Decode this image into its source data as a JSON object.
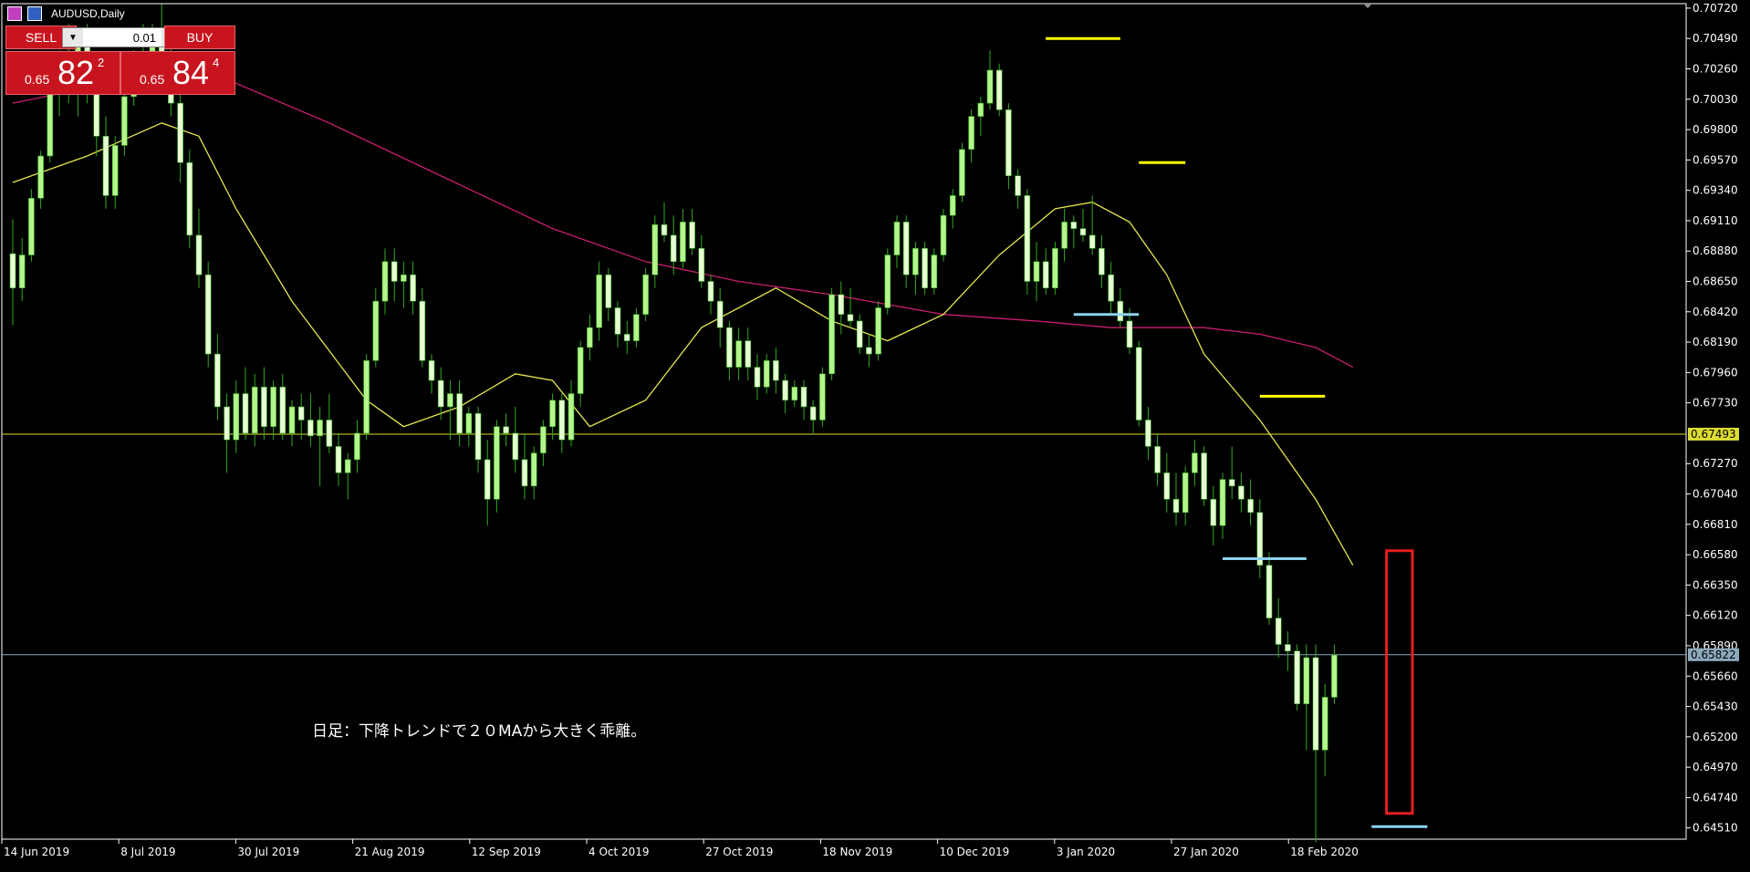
{
  "window": {
    "title": "AUDUSD,Daily"
  },
  "trade_panel": {
    "sell_label": "SELL",
    "buy_label": "BUY",
    "lot_value": "0.01",
    "sell_price": {
      "prefix": "0.65",
      "big": "82",
      "sup": "2"
    },
    "buy_price": {
      "prefix": "0.65",
      "big": "84",
      "sup": "4"
    }
  },
  "annotation": "日足：下降トレンドで２０MAから大きく乖離。",
  "colors": {
    "background": "#000000",
    "candle_bull": "#b4f58c",
    "candle_bear": "#e6ffd2",
    "wick": "#32aa1e",
    "ma20": "#e6e650",
    "ma_long": "#c81e6e",
    "hline_yellow": "#dcdc32",
    "hline_price": "#8caabe",
    "marker_yellow": "#ffff00",
    "marker_blue": "#8cd2f0",
    "highlight_box": "#e61e1e",
    "axis_text": "#ffffff"
  },
  "chart_data": {
    "type": "candlestick",
    "symbol": "AUDUSD",
    "timeframe": "Daily",
    "y_ticks": [
      "0.70720",
      "0.70490",
      "0.70260",
      "0.70030",
      "0.69800",
      "0.69570",
      "0.69340",
      "0.69110",
      "0.68880",
      "0.68650",
      "0.68420",
      "0.68190",
      "0.67960",
      "0.67730",
      "0.67270",
      "0.67040",
      "0.66810",
      "0.66580",
      "0.66350",
      "0.66120",
      "0.65890",
      "0.65660",
      "0.65430",
      "0.65200",
      "0.64970",
      "0.64740",
      "0.64510"
    ],
    "ylim": [
      0.64425,
      0.70754
    ],
    "x_ticks": [
      "14 Jun 2019",
      "8 Jul 2019",
      "30 Jul 2019",
      "21 Aug 2019",
      "12 Sep 2019",
      "4 Oct 2019",
      "27 Oct 2019",
      "18 Nov 2019",
      "10 Dec 2019",
      "3 Jan 2020",
      "27 Jan 2020",
      "18 Feb 2020"
    ],
    "horizontal_lines": [
      {
        "price": 0.67493,
        "label": "0.67493",
        "color": "yellow"
      },
      {
        "price": 0.65822,
        "label": "0.65822",
        "color": "grey-blue"
      }
    ],
    "candles": [
      [
        0.6886,
        0.6912,
        0.6832,
        0.686
      ],
      [
        0.686,
        0.6898,
        0.685,
        0.6885
      ],
      [
        0.6885,
        0.6935,
        0.688,
        0.6928
      ],
      [
        0.6928,
        0.6964,
        0.692,
        0.696
      ],
      [
        0.696,
        0.7015,
        0.6955,
        0.7008
      ],
      [
        0.7008,
        0.704,
        0.699,
        0.703
      ],
      [
        0.703,
        0.706,
        0.7,
        0.701
      ],
      [
        0.701,
        0.7055,
        0.699,
        0.7045
      ],
      [
        0.7045,
        0.706,
        0.7,
        0.7015
      ],
      [
        0.7015,
        0.703,
        0.696,
        0.6975
      ],
      [
        0.6975,
        0.699,
        0.692,
        0.693
      ],
      [
        0.693,
        0.6975,
        0.692,
        0.6968
      ],
      [
        0.6968,
        0.701,
        0.696,
        0.7005
      ],
      [
        0.7005,
        0.704,
        0.6998,
        0.703
      ],
      [
        0.703,
        0.706,
        0.7015,
        0.702
      ],
      [
        0.702,
        0.706,
        0.701,
        0.705
      ],
      [
        0.705,
        0.7075,
        0.702,
        0.703
      ],
      [
        0.703,
        0.7045,
        0.699,
        0.7
      ],
      [
        0.7,
        0.701,
        0.694,
        0.6955
      ],
      [
        0.6955,
        0.6965,
        0.689,
        0.69
      ],
      [
        0.69,
        0.692,
        0.686,
        0.687
      ],
      [
        0.687,
        0.688,
        0.68,
        0.681
      ],
      [
        0.681,
        0.6825,
        0.676,
        0.677
      ],
      [
        0.677,
        0.678,
        0.672,
        0.6745
      ],
      [
        0.6745,
        0.679,
        0.6735,
        0.678
      ],
      [
        0.678,
        0.68,
        0.6745,
        0.675
      ],
      [
        0.675,
        0.6795,
        0.674,
        0.6785
      ],
      [
        0.6785,
        0.68,
        0.6745,
        0.6755
      ],
      [
        0.6755,
        0.679,
        0.6745,
        0.6785
      ],
      [
        0.6785,
        0.6795,
        0.6745,
        0.675
      ],
      [
        0.675,
        0.6775,
        0.674,
        0.677
      ],
      [
        0.677,
        0.678,
        0.6745,
        0.676
      ],
      [
        0.676,
        0.678,
        0.674,
        0.6748
      ],
      [
        0.6748,
        0.677,
        0.671,
        0.676
      ],
      [
        0.676,
        0.678,
        0.6735,
        0.674
      ],
      [
        0.674,
        0.675,
        0.671,
        0.672
      ],
      [
        0.672,
        0.6735,
        0.67,
        0.673
      ],
      [
        0.673,
        0.676,
        0.672,
        0.675
      ],
      [
        0.675,
        0.681,
        0.6745,
        0.6805
      ],
      [
        0.6805,
        0.686,
        0.68,
        0.685
      ],
      [
        0.685,
        0.689,
        0.684,
        0.688
      ],
      [
        0.688,
        0.689,
        0.685,
        0.6865
      ],
      [
        0.6865,
        0.688,
        0.6845,
        0.687
      ],
      [
        0.687,
        0.688,
        0.684,
        0.685
      ],
      [
        0.685,
        0.686,
        0.68,
        0.6805
      ],
      [
        0.6805,
        0.681,
        0.678,
        0.679
      ],
      [
        0.679,
        0.68,
        0.676,
        0.677
      ],
      [
        0.677,
        0.679,
        0.6745,
        0.678
      ],
      [
        0.678,
        0.679,
        0.674,
        0.675
      ],
      [
        0.675,
        0.677,
        0.674,
        0.6765
      ],
      [
        0.6765,
        0.677,
        0.672,
        0.673
      ],
      [
        0.673,
        0.6745,
        0.668,
        0.67
      ],
      [
        0.67,
        0.676,
        0.669,
        0.6755
      ],
      [
        0.6755,
        0.6765,
        0.674,
        0.675
      ],
      [
        0.675,
        0.677,
        0.672,
        0.673
      ],
      [
        0.673,
        0.675,
        0.67,
        0.671
      ],
      [
        0.671,
        0.674,
        0.67,
        0.6735
      ],
      [
        0.6735,
        0.676,
        0.6725,
        0.6755
      ],
      [
        0.6755,
        0.678,
        0.6745,
        0.6775
      ],
      [
        0.6775,
        0.678,
        0.6735,
        0.6745
      ],
      [
        0.6745,
        0.679,
        0.674,
        0.678
      ],
      [
        0.678,
        0.682,
        0.677,
        0.6815
      ],
      [
        0.6815,
        0.684,
        0.6805,
        0.683
      ],
      [
        0.683,
        0.688,
        0.682,
        0.687
      ],
      [
        0.687,
        0.6875,
        0.6835,
        0.6845
      ],
      [
        0.6845,
        0.685,
        0.6815,
        0.6825
      ],
      [
        0.6825,
        0.6835,
        0.681,
        0.682
      ],
      [
        0.682,
        0.6845,
        0.6815,
        0.684
      ],
      [
        0.684,
        0.6875,
        0.6835,
        0.687
      ],
      [
        0.687,
        0.6915,
        0.686,
        0.6908
      ],
      [
        0.6908,
        0.6925,
        0.6895,
        0.69
      ],
      [
        0.69,
        0.6915,
        0.687,
        0.688
      ],
      [
        0.688,
        0.692,
        0.6875,
        0.691
      ],
      [
        0.691,
        0.692,
        0.6885,
        0.689
      ],
      [
        0.689,
        0.69,
        0.686,
        0.6865
      ],
      [
        0.6865,
        0.687,
        0.684,
        0.685
      ],
      [
        0.685,
        0.686,
        0.6815,
        0.683
      ],
      [
        0.683,
        0.6835,
        0.679,
        0.68
      ],
      [
        0.68,
        0.683,
        0.679,
        0.682
      ],
      [
        0.682,
        0.683,
        0.679,
        0.68
      ],
      [
        0.68,
        0.681,
        0.6775,
        0.6785
      ],
      [
        0.6785,
        0.681,
        0.678,
        0.6805
      ],
      [
        0.6805,
        0.6815,
        0.678,
        0.679
      ],
      [
        0.679,
        0.6795,
        0.6765,
        0.6775
      ],
      [
        0.6775,
        0.679,
        0.677,
        0.6785
      ],
      [
        0.6785,
        0.679,
        0.676,
        0.677
      ],
      [
        0.677,
        0.6775,
        0.675,
        0.676
      ],
      [
        0.676,
        0.68,
        0.6755,
        0.6795
      ],
      [
        0.6795,
        0.686,
        0.679,
        0.6855
      ],
      [
        0.6855,
        0.6865,
        0.6825,
        0.684
      ],
      [
        0.684,
        0.686,
        0.683,
        0.6835
      ],
      [
        0.6835,
        0.684,
        0.681,
        0.6815
      ],
      [
        0.6815,
        0.6825,
        0.68,
        0.681
      ],
      [
        0.681,
        0.685,
        0.6805,
        0.6845
      ],
      [
        0.6845,
        0.689,
        0.684,
        0.6885
      ],
      [
        0.6885,
        0.6915,
        0.6875,
        0.691
      ],
      [
        0.691,
        0.6915,
        0.686,
        0.687
      ],
      [
        0.687,
        0.6895,
        0.6855,
        0.689
      ],
      [
        0.689,
        0.6895,
        0.6855,
        0.686
      ],
      [
        0.686,
        0.689,
        0.6855,
        0.6885
      ],
      [
        0.6885,
        0.692,
        0.688,
        0.6915
      ],
      [
        0.6915,
        0.6935,
        0.6905,
        0.693
      ],
      [
        0.693,
        0.697,
        0.6925,
        0.6965
      ],
      [
        0.6965,
        0.6995,
        0.6955,
        0.699
      ],
      [
        0.699,
        0.7005,
        0.6975,
        0.7
      ],
      [
        0.7,
        0.704,
        0.6995,
        0.7025
      ],
      [
        0.7025,
        0.703,
        0.699,
        0.6995
      ],
      [
        0.6995,
        0.7,
        0.6935,
        0.6945
      ],
      [
        0.6945,
        0.695,
        0.692,
        0.693
      ],
      [
        0.693,
        0.6935,
        0.6855,
        0.6865
      ],
      [
        0.6865,
        0.6895,
        0.685,
        0.688
      ],
      [
        0.688,
        0.689,
        0.6855,
        0.686
      ],
      [
        0.686,
        0.6895,
        0.6855,
        0.689
      ],
      [
        0.689,
        0.692,
        0.688,
        0.691
      ],
      [
        0.691,
        0.6915,
        0.689,
        0.6905
      ],
      [
        0.6905,
        0.692,
        0.6895,
        0.69
      ],
      [
        0.69,
        0.693,
        0.6885,
        0.689
      ],
      [
        0.689,
        0.69,
        0.686,
        0.687
      ],
      [
        0.687,
        0.688,
        0.684,
        0.685
      ],
      [
        0.685,
        0.686,
        0.683,
        0.6835
      ],
      [
        0.6835,
        0.6845,
        0.681,
        0.6815
      ],
      [
        0.6815,
        0.682,
        0.6755,
        0.676
      ],
      [
        0.676,
        0.677,
        0.673,
        0.674
      ],
      [
        0.674,
        0.675,
        0.671,
        0.672
      ],
      [
        0.672,
        0.6735,
        0.669,
        0.67
      ],
      [
        0.67,
        0.672,
        0.668,
        0.669
      ],
      [
        0.669,
        0.6725,
        0.668,
        0.672
      ],
      [
        0.672,
        0.6745,
        0.671,
        0.6735
      ],
      [
        0.6735,
        0.674,
        0.6695,
        0.67
      ],
      [
        0.67,
        0.671,
        0.6665,
        0.668
      ],
      [
        0.668,
        0.672,
        0.667,
        0.6715
      ],
      [
        0.6715,
        0.674,
        0.67,
        0.671
      ],
      [
        0.671,
        0.672,
        0.669,
        0.67
      ],
      [
        0.67,
        0.6715,
        0.668,
        0.669
      ],
      [
        0.669,
        0.67,
        0.664,
        0.665
      ],
      [
        0.665,
        0.666,
        0.6605,
        0.661
      ],
      [
        0.661,
        0.6625,
        0.658,
        0.659
      ],
      [
        0.659,
        0.66,
        0.657,
        0.6585
      ],
      [
        0.6585,
        0.659,
        0.654,
        0.6545
      ],
      [
        0.6545,
        0.659,
        0.651,
        0.658
      ],
      [
        0.658,
        0.659,
        0.644,
        0.651
      ],
      [
        0.651,
        0.656,
        0.649,
        0.655
      ],
      [
        0.655,
        0.659,
        0.6545,
        0.6582
      ]
    ],
    "ma20": [
      [
        0,
        0.694
      ],
      [
        8,
        0.696
      ],
      [
        16,
        0.6985
      ],
      [
        20,
        0.6975
      ],
      [
        24,
        0.692
      ],
      [
        30,
        0.685
      ],
      [
        38,
        0.6775
      ],
      [
        42,
        0.6755
      ],
      [
        48,
        0.677
      ],
      [
        54,
        0.6795
      ],
      [
        58,
        0.679
      ],
      [
        62,
        0.6755
      ],
      [
        68,
        0.6775
      ],
      [
        74,
        0.683
      ],
      [
        82,
        0.686
      ],
      [
        88,
        0.6835
      ],
      [
        94,
        0.682
      ],
      [
        100,
        0.684
      ],
      [
        106,
        0.6885
      ],
      [
        112,
        0.692
      ],
      [
        116,
        0.6925
      ],
      [
        120,
        0.691
      ],
      [
        124,
        0.687
      ],
      [
        128,
        0.681
      ],
      [
        134,
        0.676
      ],
      [
        140,
        0.67
      ],
      [
        144,
        0.665
      ]
    ],
    "ma_long": [
      [
        0,
        0.7
      ],
      [
        14,
        0.702
      ],
      [
        24,
        0.7015
      ],
      [
        34,
        0.6985
      ],
      [
        46,
        0.6945
      ],
      [
        58,
        0.6905
      ],
      [
        68,
        0.688
      ],
      [
        78,
        0.6865
      ],
      [
        88,
        0.6855
      ],
      [
        100,
        0.684
      ],
      [
        110,
        0.6835
      ],
      [
        118,
        0.683
      ],
      [
        128,
        0.683
      ],
      [
        134,
        0.6825
      ],
      [
        140,
        0.6815
      ],
      [
        144,
        0.68
      ]
    ],
    "markers": [
      {
        "color": "yellow",
        "x": [
          111,
          119
        ],
        "y": 0.7049
      },
      {
        "color": "yellow",
        "x": [
          121,
          126
        ],
        "y": 0.6955
      },
      {
        "color": "yellow",
        "x": [
          134,
          141
        ],
        "y": 0.6778
      },
      {
        "color": "blue",
        "x": [
          114,
          121
        ],
        "y": 0.684
      },
      {
        "color": "blue",
        "x": [
          130,
          139
        ],
        "y": 0.6655
      },
      {
        "color": "blue",
        "x": [
          146,
          152
        ],
        "y": 0.6452
      }
    ],
    "highlight": {
      "x": [
        148,
        150
      ],
      "y": [
        0.6462,
        0.6661
      ]
    }
  }
}
